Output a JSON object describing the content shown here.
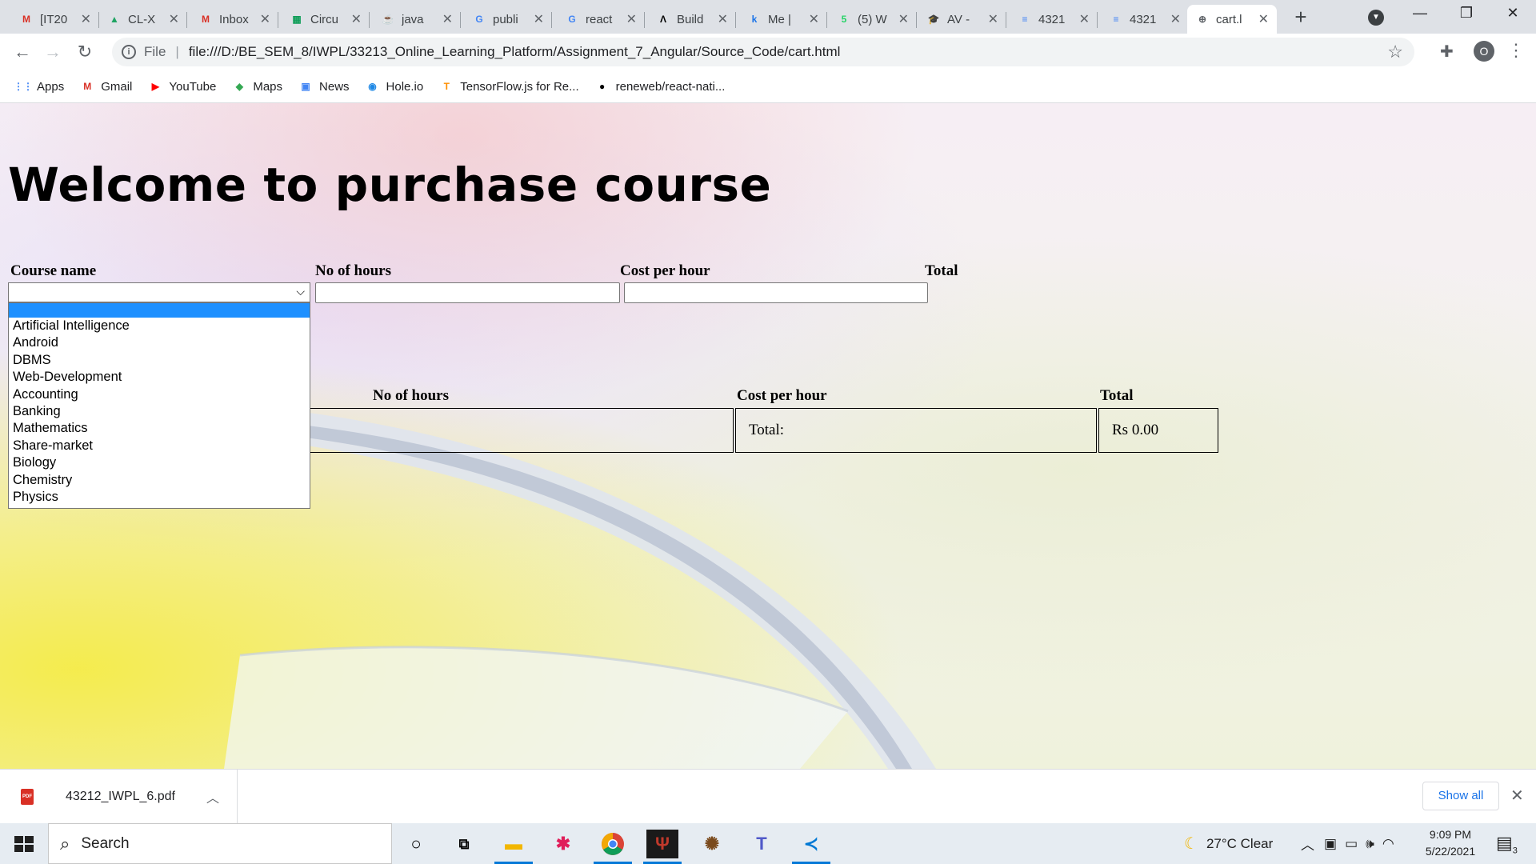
{
  "browser": {
    "tabs": [
      {
        "title": "[IT20",
        "favicon": "gmail-icon",
        "color": "#d93025",
        "glyph": "M"
      },
      {
        "title": "CL-X",
        "favicon": "drive-icon",
        "color": "#1fa463",
        "glyph": "▲"
      },
      {
        "title": "Inbox",
        "favicon": "gmail-icon",
        "color": "#d93025",
        "glyph": "M"
      },
      {
        "title": "Circu",
        "favicon": "circuit-icon",
        "color": "#0f9d58",
        "glyph": "▦"
      },
      {
        "title": "java",
        "favicon": "java-icon",
        "color": "#e76f00",
        "glyph": "☕"
      },
      {
        "title": "publi",
        "favicon": "google-icon",
        "color": "#4285f4",
        "glyph": "G"
      },
      {
        "title": "react",
        "favicon": "google-icon",
        "color": "#4285f4",
        "glyph": "G"
      },
      {
        "title": "Build",
        "favicon": "build-icon",
        "color": "#000000",
        "glyph": "Λ"
      },
      {
        "title": "Me |",
        "favicon": "k-icon",
        "color": "#1a73e8",
        "glyph": "k"
      },
      {
        "title": "(5) W",
        "favicon": "whatsapp-icon",
        "color": "#25d366",
        "glyph": "5"
      },
      {
        "title": "AV -",
        "favicon": "graduation-icon",
        "color": "#3c4043",
        "glyph": "🎓"
      },
      {
        "title": "4321",
        "favicon": "docs-icon",
        "color": "#4285f4",
        "glyph": "≡"
      },
      {
        "title": "4321",
        "favicon": "docs-icon",
        "color": "#4285f4",
        "glyph": "≡"
      },
      {
        "title": "cart.l",
        "favicon": "globe-icon",
        "color": "#5f6368",
        "glyph": "⊕"
      }
    ],
    "new_tab_glyph": "+",
    "window_controls": {
      "minimize": "—",
      "maximize": "❐",
      "close": "✕"
    },
    "url_scheme_label": "File",
    "url": "file:///D:/BE_SEM_8/IWPL/33213_Online_Learning_Platform/Assignment_7_Angular/Source_Code/cart.html",
    "profile_initial": "O",
    "bookmarks": [
      {
        "label": "Apps",
        "icon": "apps-grid-icon",
        "color": "#4285f4",
        "glyph": "⋮⋮"
      },
      {
        "label": "Gmail",
        "icon": "gmail-icon",
        "color": "#d93025",
        "glyph": "M"
      },
      {
        "label": "YouTube",
        "icon": "youtube-icon",
        "color": "#ff0000",
        "glyph": "▶"
      },
      {
        "label": "Maps",
        "icon": "maps-icon",
        "color": "#34a853",
        "glyph": "◆"
      },
      {
        "label": "News",
        "icon": "news-icon",
        "color": "#4285f4",
        "glyph": "▣"
      },
      {
        "label": "Hole.io",
        "icon": "holeio-icon",
        "color": "#1e88e5",
        "glyph": "◉"
      },
      {
        "label": "TensorFlow.js for Re...",
        "icon": "tensorflow-icon",
        "color": "#ff8f00",
        "glyph": "T"
      },
      {
        "label": "reneweb/react-nati...",
        "icon": "github-icon",
        "color": "#000000",
        "glyph": "●"
      }
    ]
  },
  "page": {
    "heading": "Welcome to purchase course",
    "form": {
      "course_label": "Course name",
      "hours_label": "No of hours",
      "cost_label": "Cost per hour",
      "total_label": "Total",
      "course_value": "",
      "hours_value": "",
      "cost_value": ""
    },
    "dropdown_options": [
      "Artificial Intelligence",
      "Android",
      "DBMS",
      "Web-Development",
      "Accounting",
      "Banking",
      "Mathematics",
      "Share-market",
      "Biology",
      "Chemistry",
      "Physics"
    ],
    "cart_table": {
      "headers": {
        "hours": "No of hours",
        "cost": "Cost per hour",
        "total": "Total"
      },
      "total_label": "Total:",
      "total_value": "Rs 0.00"
    }
  },
  "downloads": {
    "file_name": "43212_IWPL_6.pdf",
    "show_all": "Show all"
  },
  "taskbar": {
    "search_placeholder": "Search",
    "weather": "27°C  Clear",
    "time": "9:09 PM",
    "date": "5/22/2021",
    "notification_count": "3",
    "accent": "#0078d7"
  }
}
